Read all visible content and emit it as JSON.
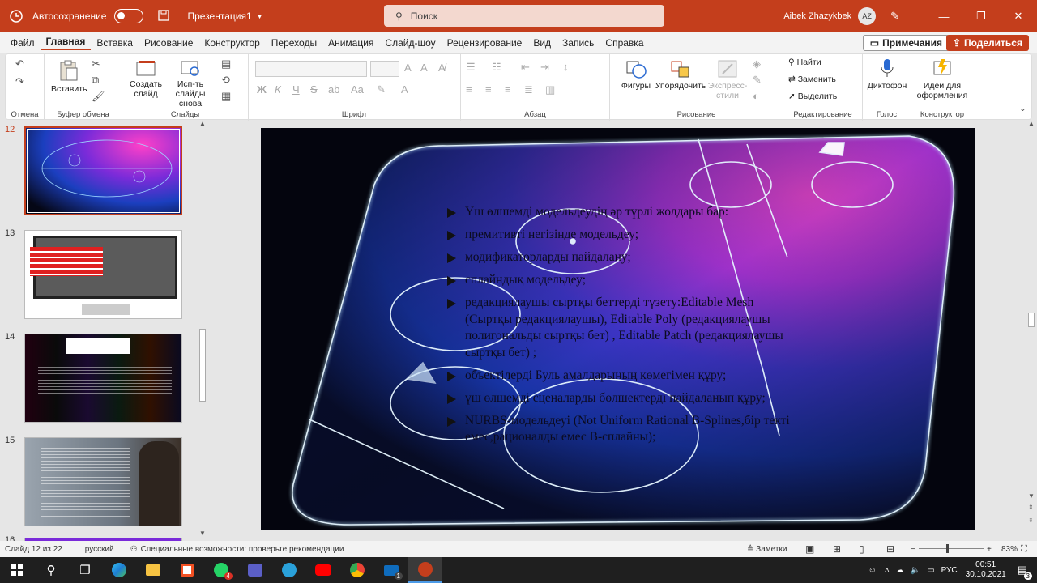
{
  "titlebar": {
    "autosave_label": "Автосохранение",
    "doc_title": "Презентация1",
    "search_placeholder": "Поиск",
    "user_name": "Aibek Zhazykbek",
    "user_initials": "AZ"
  },
  "menu": {
    "items": [
      "Файл",
      "Главная",
      "Вставка",
      "Рисование",
      "Конструктор",
      "Переходы",
      "Анимация",
      "Слайд-шоу",
      "Рецензирование",
      "Вид",
      "Запись",
      "Справка"
    ],
    "active": "Главная",
    "notes_label": "Примечания",
    "share_label": "Поделиться"
  },
  "ribbon": {
    "groups": {
      "undo": "Отмена",
      "clipboard": "Буфер обмена",
      "slides": "Слайды",
      "font": "Шрифт",
      "paragraph": "Абзац",
      "drawing": "Рисование",
      "editing": "Редактирование",
      "voice": "Голос",
      "designer": "Конструктор"
    },
    "paste": "Вставить",
    "new_slide": "Создать слайд",
    "reuse_slides": "Исп-ть слайды снова",
    "shapes": "Фигуры",
    "arrange": "Упорядочить",
    "quick_styles": "Экспресс-стили",
    "find": "Найти",
    "replace": "Заменить",
    "select": "Выделить",
    "dictate": "Диктофон",
    "design_ideas": "Идеи для оформления",
    "font_bold": "Ж",
    "font_italic": "К",
    "font_underline": "Ч",
    "font_strike": "S"
  },
  "thumbnails": [
    {
      "num": "12",
      "selected": true
    },
    {
      "num": "13",
      "selected": false
    },
    {
      "num": "14",
      "selected": false
    },
    {
      "num": "15",
      "selected": false
    },
    {
      "num": "16",
      "selected": false
    }
  ],
  "slide": {
    "bullets": [
      "Үш өлшемді модельдеудің әр түрлі жолдары бар:",
      "премитивті негізінде модельдеу;",
      "модификаторларды пайдалану;",
      "сплайндық модельдеу;",
      "редакциялаушы сыртқы беттерді түзету:Editable Mesh (Сыртқы редакциялаушы), Editable Poly (редакциялаушы полигональды сыртқы бет) , Editable Patch (редакциялаушы сыртқы бет) ;",
      "объектілерді Буль амалдарының көмегімен құру;",
      "үш өлшемді сценаларды бөлшектерді пайдаланып құру;",
      "NURBS-модельдеуі (Not Uniform Rational B-Splines,бір текті емес,рационалды емес B-сплайны);"
    ]
  },
  "status": {
    "slide_counter": "Слайд 12 из 22",
    "language": "русский",
    "accessibility": "Специальные возможности: проверьте рекомендации",
    "notes": "Заметки",
    "zoom": "83%"
  },
  "taskbar": {
    "lang": "РУС",
    "time": "00:51",
    "date": "30.10.2021",
    "whatsapp_badge": "4",
    "mail_badge": "1",
    "notif_badge": "3"
  },
  "colors": {
    "accent": "#c43e1c",
    "rink_pink": "#ff3cc8",
    "rink_blue": "#2a7bff"
  }
}
